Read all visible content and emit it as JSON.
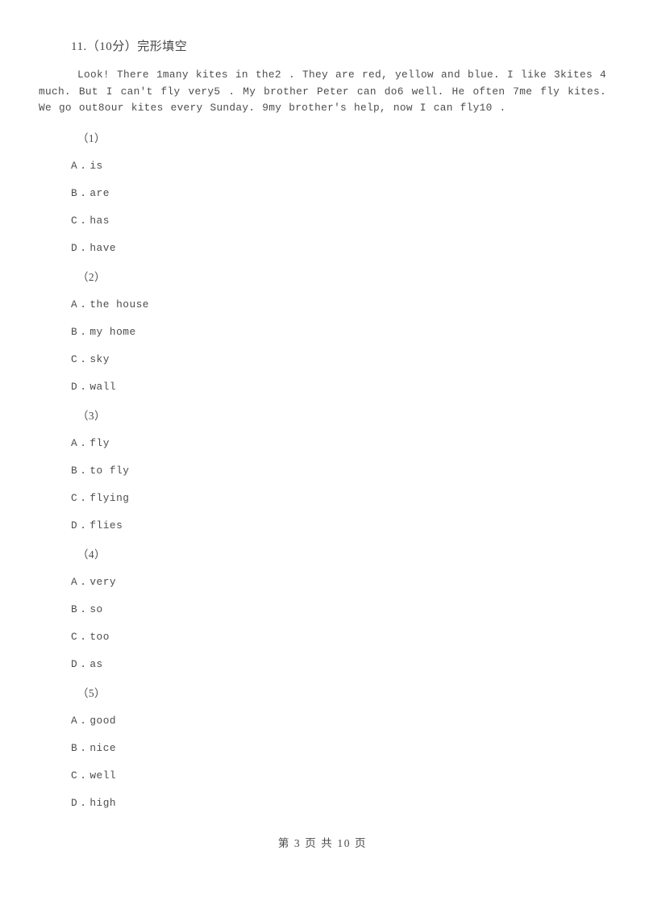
{
  "document": {
    "question_number_heading": "11.（10分）完形填空",
    "passage": "Look! There  1many kites in the2 .  They are red, yellow and blue. I like 3kites 4 much. But I can't fly very5 .  My brother Peter can do6 well. He often 7me fly kites. We go out8our kites every Sunday. 9my brother's help, now I can fly10 ."
  },
  "questions": [
    {
      "label": "（1）",
      "options": [
        {
          "letter": "A",
          "separator": ".",
          "text": "is"
        },
        {
          "letter": "B",
          "separator": ".",
          "text": "are"
        },
        {
          "letter": "C",
          "separator": ".",
          "text": "has"
        },
        {
          "letter": "D",
          "separator": ".",
          "text": "have"
        }
      ]
    },
    {
      "label": "（2）",
      "options": [
        {
          "letter": "A",
          "separator": ".",
          "text": "the house"
        },
        {
          "letter": "B",
          "separator": ".",
          "text": "my home"
        },
        {
          "letter": "C",
          "separator": ".",
          "text": "sky"
        },
        {
          "letter": "D",
          "separator": ".",
          "text": "wall"
        }
      ]
    },
    {
      "label": "（3）",
      "options": [
        {
          "letter": "A",
          "separator": ".",
          "text": "fly"
        },
        {
          "letter": "B",
          "separator": ".",
          "text": "to fly"
        },
        {
          "letter": "C",
          "separator": ".",
          "text": "flying"
        },
        {
          "letter": "D",
          "separator": ".",
          "text": "flies"
        }
      ]
    },
    {
      "label": "（4）",
      "options": [
        {
          "letter": "A",
          "separator": ".",
          "text": "very"
        },
        {
          "letter": "B",
          "separator": ".",
          "text": "so"
        },
        {
          "letter": "C",
          "separator": ".",
          "text": "too"
        },
        {
          "letter": "D",
          "separator": ".",
          "text": "as"
        }
      ]
    },
    {
      "label": "（5）",
      "options": [
        {
          "letter": "A",
          "separator": ".",
          "text": "good"
        },
        {
          "letter": "B",
          "separator": ".",
          "text": "nice"
        },
        {
          "letter": "C",
          "separator": ".",
          "text": "well"
        },
        {
          "letter": "D",
          "separator": ".",
          "text": "high"
        }
      ]
    }
  ],
  "footer": {
    "page_indicator": "第 3 页 共 10 页"
  }
}
